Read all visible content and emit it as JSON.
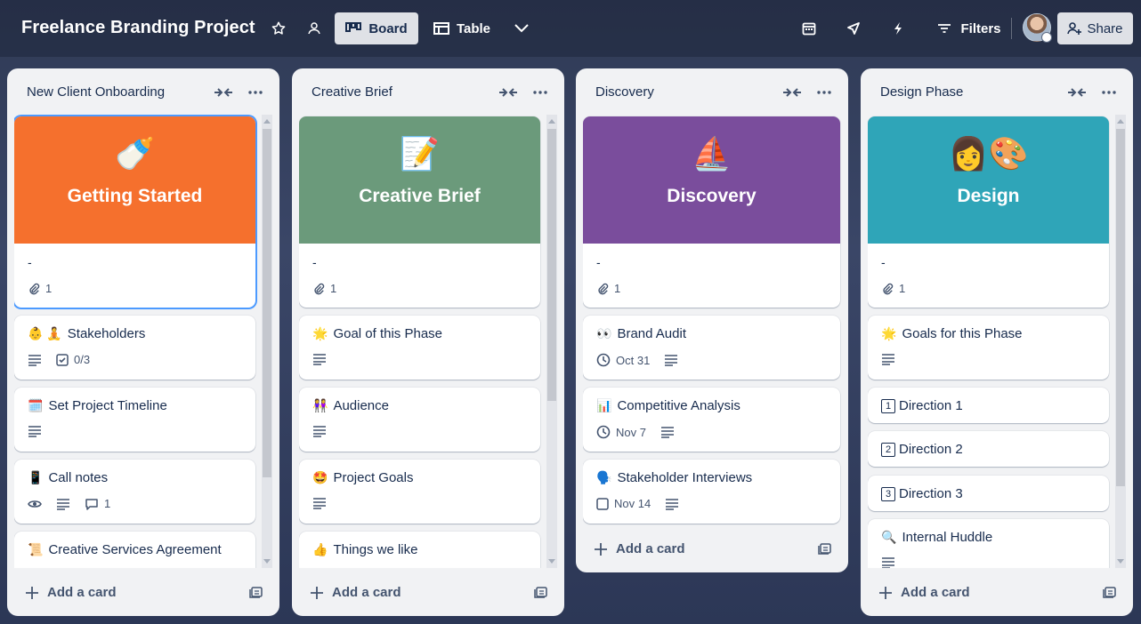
{
  "header": {
    "board_title": "Freelance Branding Project",
    "views": [
      {
        "label": "Board",
        "active": true
      },
      {
        "label": "Table",
        "active": false
      }
    ],
    "filters_label": "Filters",
    "share_label": "Share"
  },
  "lists": [
    {
      "title": "New Client Onboarding",
      "add_card_label": "Add a card",
      "cover": {
        "emoji": "🍼",
        "title": "Getting Started",
        "color": "#f5702d",
        "text": "-",
        "attachments": "1"
      },
      "cards": [
        {
          "emoji": "👶 🧘",
          "title": "Stakeholders",
          "checklist": "0/3"
        },
        {
          "emoji": "🗓️",
          "title": "Set Project Timeline"
        },
        {
          "emoji": "📱",
          "title": "Call notes",
          "comments": "1"
        },
        {
          "emoji": "📜",
          "title": "Creative Services Agreement"
        }
      ]
    },
    {
      "title": "Creative Brief",
      "add_card_label": "Add a card",
      "cover": {
        "emoji": "📝",
        "title": "Creative Brief",
        "color": "#6b9a7b",
        "text": "-",
        "attachments": "1"
      },
      "cards": [
        {
          "emoji": "🌟",
          "title": "Goal of this Phase"
        },
        {
          "emoji": "👭",
          "title": "Audience"
        },
        {
          "emoji": "🤩",
          "title": "Project Goals"
        },
        {
          "emoji": "👍",
          "title": "Things we like"
        }
      ]
    },
    {
      "title": "Discovery",
      "add_card_label": "Add a card",
      "cover": {
        "emoji": "⛵",
        "title": "Discovery",
        "color": "#7a4d9c",
        "text": "-",
        "attachments": "1"
      },
      "cards": [
        {
          "emoji": "👀",
          "title": "Brand Audit",
          "date": "Oct 31"
        },
        {
          "emoji": "📊",
          "title": "Competitive Analysis",
          "date": "Nov 7"
        },
        {
          "emoji": "🗣️",
          "title": "Stakeholder Interviews",
          "date": "Nov 14"
        }
      ]
    },
    {
      "title": "Design Phase",
      "add_card_label": "Add a card",
      "cover": {
        "emoji": "👩🎨",
        "title": "Design",
        "color": "#2fa5b8",
        "text": "-",
        "attachments": "1"
      },
      "cards": [
        {
          "emoji": "🌟",
          "title": "Goals for this Phase"
        },
        {
          "num": "1",
          "title": "Direction 1"
        },
        {
          "num": "2",
          "title": "Direction 2"
        },
        {
          "num": "3",
          "title": "Direction 3"
        },
        {
          "emoji": "🔍",
          "title": "Internal Huddle"
        }
      ]
    }
  ],
  "colors": {
    "header_active_bg": "#dfe1e6",
    "list_bg": "#f1f2f4",
    "selected_outline": "#4c9aff"
  }
}
